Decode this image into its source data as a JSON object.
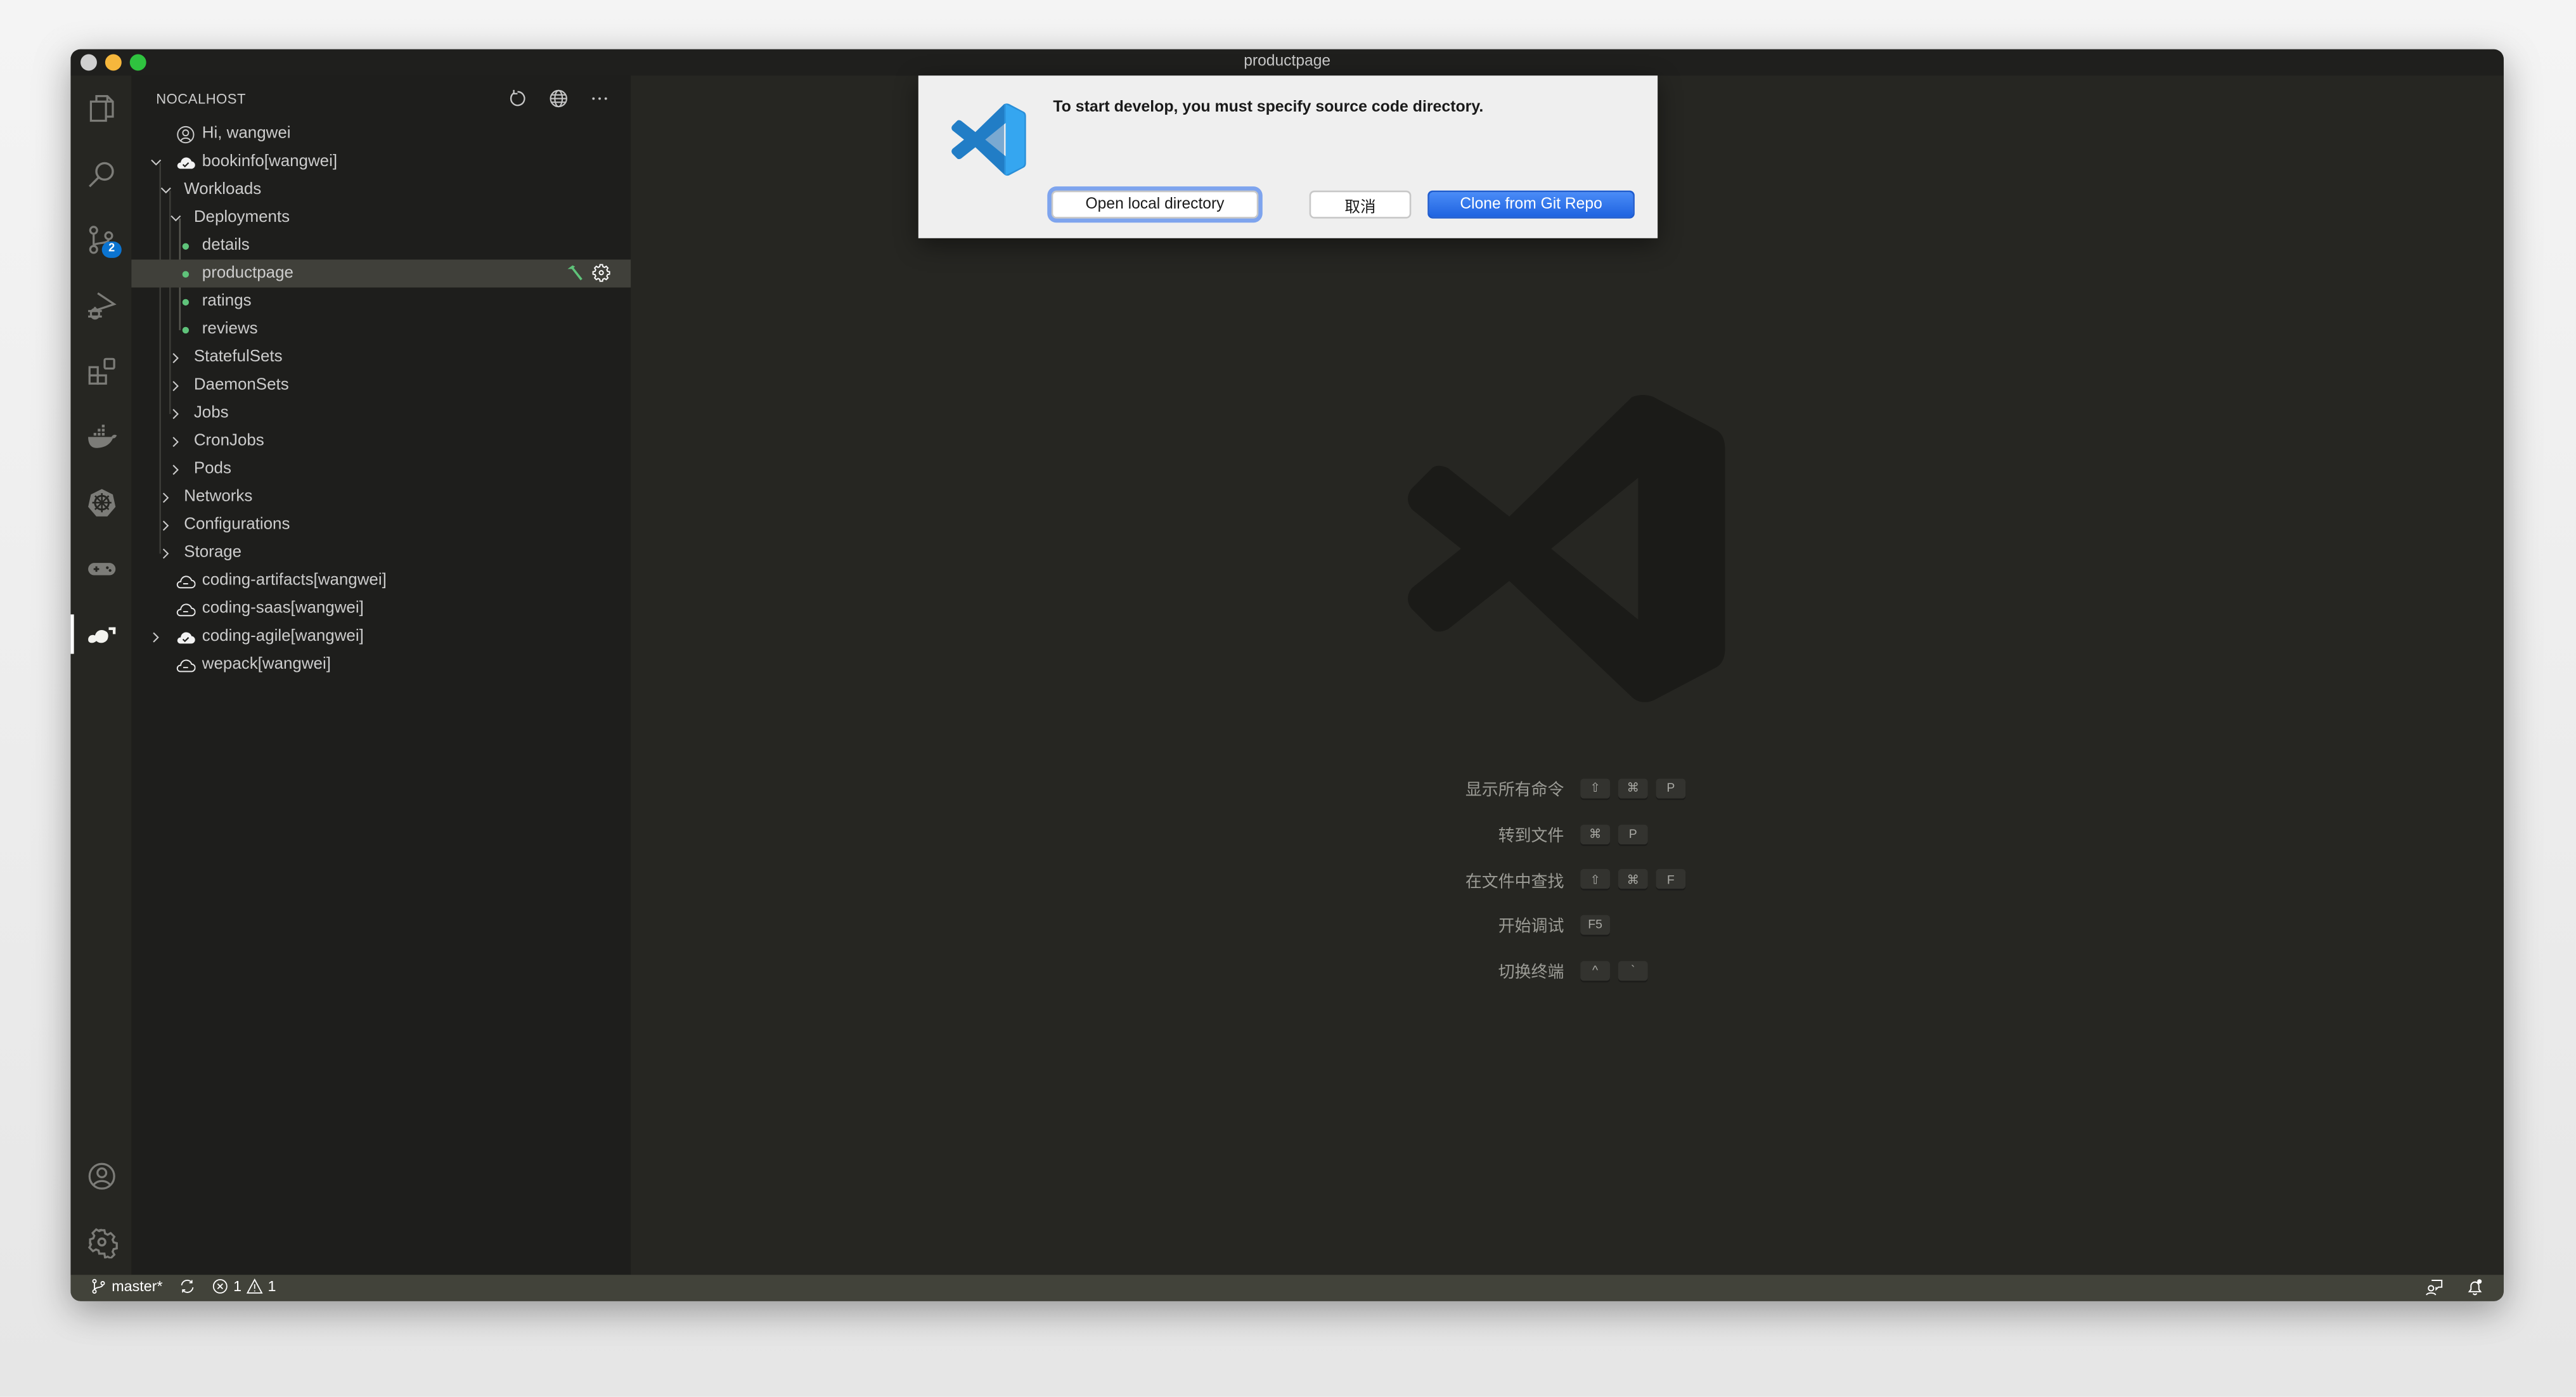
{
  "window": {
    "title": "productpage"
  },
  "activity_bar": {
    "items": [
      {
        "name": "explorer",
        "icon": "files-icon"
      },
      {
        "name": "search",
        "icon": "search-icon"
      },
      {
        "name": "source-control",
        "icon": "source-control-icon",
        "badge": "2"
      },
      {
        "name": "run-debug",
        "icon": "run-debug-icon"
      },
      {
        "name": "extensions",
        "icon": "extensions-icon"
      },
      {
        "name": "docker",
        "icon": "docker-icon"
      },
      {
        "name": "kubernetes",
        "icon": "kubernetes-icon"
      },
      {
        "name": "gamepad",
        "icon": "gamepad-icon"
      },
      {
        "name": "nocalhost",
        "icon": "nocalhost-icon",
        "active": true
      }
    ],
    "bottom": [
      {
        "name": "accounts",
        "icon": "account-icon"
      },
      {
        "name": "manage",
        "icon": "gear-icon"
      }
    ]
  },
  "sidebar": {
    "title": "NOCALHOST",
    "actions": [
      "refresh-icon",
      "globe-icon",
      "more-icon"
    ],
    "tree": {
      "greeting": "Hi, wangwei",
      "app_bookinfo": "bookinfo[wangwei]",
      "workloads": "Workloads",
      "deployments": "Deployments",
      "deployment_items": [
        "details",
        "productpage",
        "ratings",
        "reviews"
      ],
      "selected": "productpage",
      "workload_groups": [
        "StatefulSets",
        "DaemonSets",
        "Jobs",
        "CronJobs",
        "Pods"
      ],
      "app_groups": [
        "Networks",
        "Configurations",
        "Storage"
      ],
      "apps": [
        {
          "label": "coding-artifacts[wangwei]",
          "status": "not-installed"
        },
        {
          "label": "coding-saas[wangwei]",
          "status": "not-installed"
        },
        {
          "label": "coding-agile[wangwei]",
          "status": "installed"
        },
        {
          "label": "wepack[wangwei]",
          "status": "not-installed"
        }
      ]
    }
  },
  "dialog": {
    "message": "To start develop, you must specify source code directory.",
    "buttons": {
      "open_local": "Open local directory",
      "cancel": "取消",
      "clone": "Clone from Git Repo"
    }
  },
  "editor": {
    "shortcuts": [
      {
        "label": "显示所有命令",
        "keys": [
          "⇧",
          "⌘",
          "P"
        ]
      },
      {
        "label": "转到文件",
        "keys": [
          "⌘",
          "P"
        ]
      },
      {
        "label": "在文件中查找",
        "keys": [
          "⇧",
          "⌘",
          "F"
        ]
      },
      {
        "label": "开始调试",
        "keys": [
          "F5"
        ]
      },
      {
        "label": "切换终端",
        "keys": [
          "^",
          "`"
        ]
      }
    ]
  },
  "statusbar": {
    "branch": "master*",
    "errors": "1",
    "warnings": "1"
  },
  "colors": {
    "accent_blue": "#1f63e0",
    "running_green": "#5fc37a",
    "badge_blue": "#0b74d1",
    "statusbar_bg": "#42433a"
  }
}
